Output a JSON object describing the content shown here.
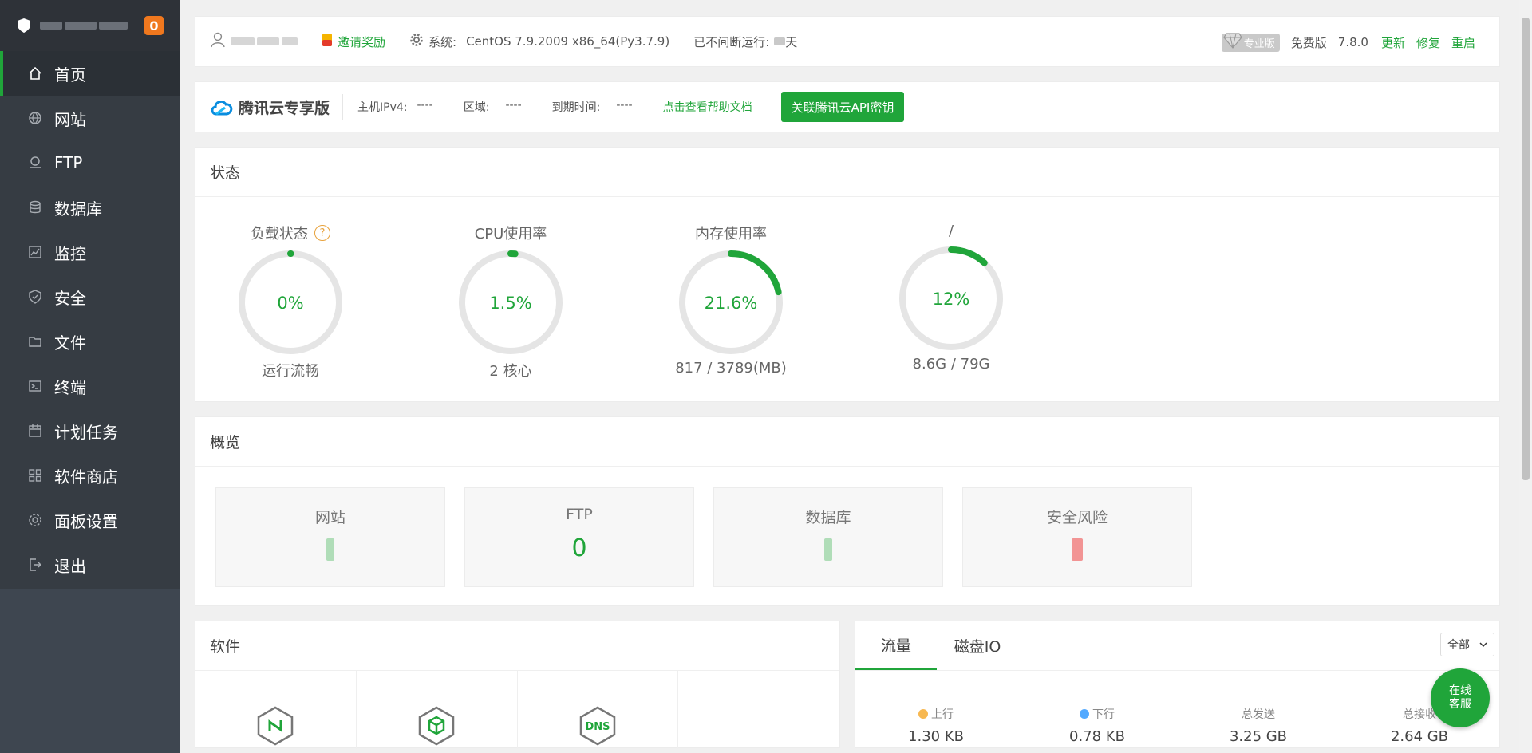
{
  "sidebar": {
    "badge": "0",
    "items": [
      {
        "label": "首页"
      },
      {
        "label": "网站"
      },
      {
        "label": "FTP"
      },
      {
        "label": "数据库"
      },
      {
        "label": "监控"
      },
      {
        "label": "安全"
      },
      {
        "label": "文件"
      },
      {
        "label": "终端"
      },
      {
        "label": "计划任务"
      },
      {
        "label": "软件商店"
      },
      {
        "label": "面板设置"
      },
      {
        "label": "退出"
      }
    ]
  },
  "topbar": {
    "invite": "邀请奖励",
    "system_label": "系统:",
    "system_value": "CentOS 7.9.2009 x86_64(Py3.7.9)",
    "uptime_label": "已不间断运行:",
    "uptime_unit": "天",
    "pro": "专业版",
    "free": "免费版",
    "version": "7.8.0",
    "update": "更新",
    "repair": "修复",
    "restart": "重启"
  },
  "tencent": {
    "title": "腾讯云专享版",
    "ipv4_label": "主机IPv4:",
    "ipv4_value": "----",
    "region_label": "区域:",
    "region_value": "----",
    "expire_label": "到期时间:",
    "expire_value": "----",
    "help_link": "点击查看帮助文档",
    "api_button": "关联腾讯云API密钥"
  },
  "status": {
    "title": "状态",
    "gauges": [
      {
        "title": "负载状态",
        "value": "0%",
        "percent": 0,
        "sub": "运行流畅"
      },
      {
        "title": "CPU使用率",
        "value": "1.5%",
        "percent": 1.5,
        "sub": "2 核心"
      },
      {
        "title": "内存使用率",
        "value": "21.6%",
        "percent": 21.6,
        "sub": "817 / 3789(MB)"
      },
      {
        "title": "/",
        "value": "12%",
        "percent": 12,
        "sub": "8.6G / 79G"
      }
    ]
  },
  "overview": {
    "title": "概览",
    "boxes": [
      {
        "label": "网站",
        "value": ""
      },
      {
        "label": "FTP",
        "value": "0"
      },
      {
        "label": "数据库",
        "value": ""
      },
      {
        "label": "安全风险",
        "value": ""
      }
    ]
  },
  "software": {
    "title": "软件"
  },
  "traffic": {
    "tabs": [
      "流量",
      "磁盘IO"
    ],
    "select": "全部",
    "stats": [
      {
        "label": "上行",
        "value": "1.30 KB",
        "color": "#f7b851"
      },
      {
        "label": "下行",
        "value": "0.78 KB",
        "color": "#52a9ff"
      },
      {
        "label": "总发送",
        "value": "3.25 GB"
      },
      {
        "label": "总接收",
        "value": "2.64 GB"
      }
    ]
  },
  "online_service": "在线\n客服",
  "colors": {
    "accent": "#20a53a",
    "sidebar": "#363c43",
    "badge": "#f0781e"
  }
}
